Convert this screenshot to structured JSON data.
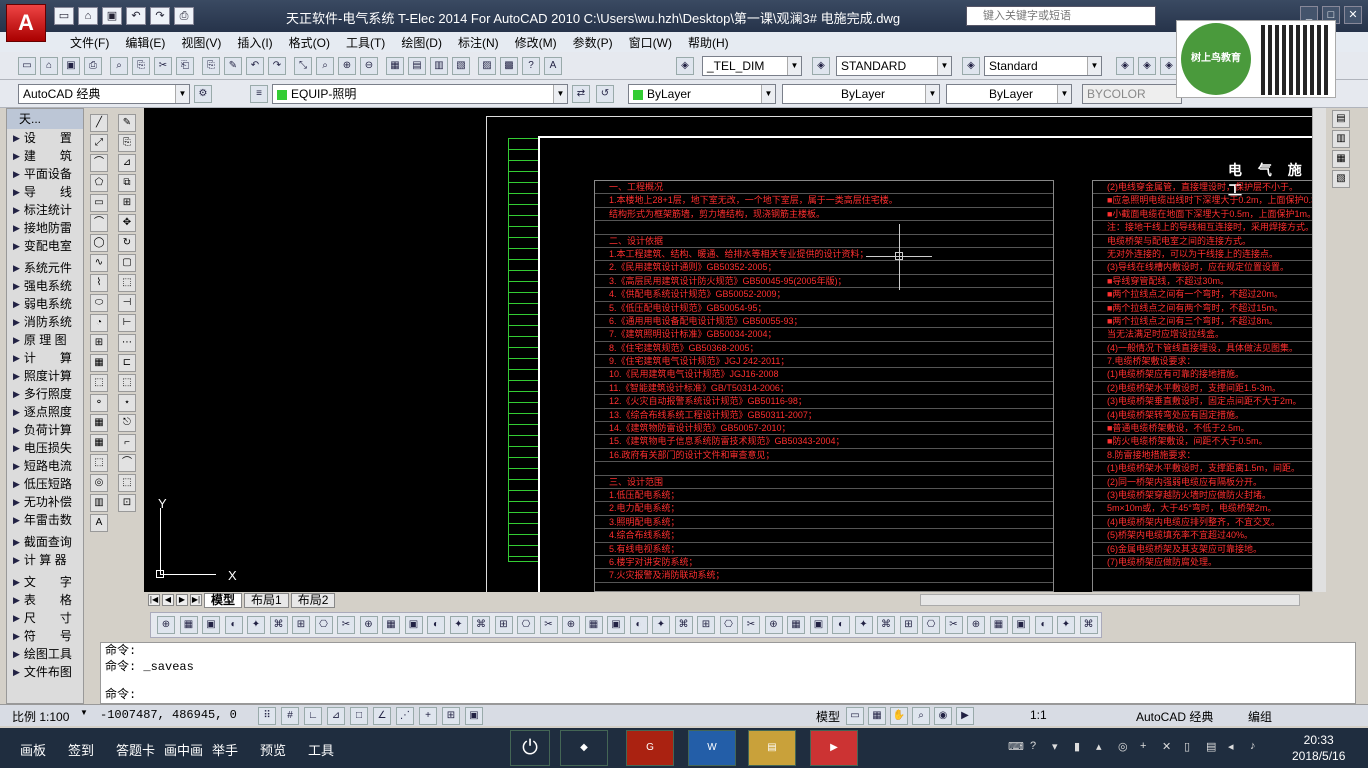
{
  "window": {
    "title": "天正软件-电气系统 T-Elec 2014  For AutoCAD 2010    C:\\Users\\wu.hzh\\Desktop\\第一课\\观澜3# 电施完成.dwg",
    "search_placeholder": "键入关键字或短语",
    "logo_letter": "A"
  },
  "menu": [
    "文件(F)",
    "编辑(E)",
    "视图(V)",
    "插入(I)",
    "格式(O)",
    "工具(T)",
    "绘图(D)",
    "标注(N)",
    "修改(M)",
    "参数(P)",
    "窗口(W)",
    "帮助(H)"
  ],
  "watermark": {
    "logo_text": "树上鸟教育"
  },
  "toolbar2": {
    "dimstyle": "_TEL_DIM",
    "textstyle": "STANDARD",
    "tablestyle": "Standard"
  },
  "toolbar3": {
    "workspace": "AutoCAD 经典",
    "layer": "EQUIP-照明",
    "color": "ByLayer",
    "linetype": "ByLayer",
    "lineweight": "ByLayer",
    "plotstyle": "BYCOLOR"
  },
  "leftpanel": {
    "title": "天...",
    "items": [
      "设　　置",
      "建　　筑",
      "平面设备",
      "导　　线",
      "标注统计",
      "接地防雷",
      "变配电室",
      "",
      "系统元件",
      "强电系统",
      "弱电系统",
      "消防系统",
      "原 理 图",
      "计　　算",
      "照度计算",
      "多行照度",
      "逐点照度",
      "负荷计算",
      "电压损失",
      "短路电流",
      "低压短路",
      "无功补偿",
      "年雷击数",
      "",
      "截面查询",
      "计 算 器",
      "",
      "文　　字",
      "表　　格",
      "尺　　寸",
      "符　　号",
      "绘图工具",
      "文件布图"
    ]
  },
  "drawing": {
    "sheet_title": "电 气 施 工",
    "col1": [
      "一、工程概况",
      "1.本楼地上28+1层，地下室无改，一个地下室层，属于一类高层住宅楼。",
      "结构形式为框架筋墙，剪力墙结构，现浇钢筋主楼板。",
      "",
      "二、设计依据",
      "1.本工程建筑、结构、暖通、给排水等相关专业提供的设计资料；",
      "2.《民用建筑设计通则》GB50352-2005；",
      "3.《高层民用建筑设计防火规范》GB50045-95(2005年版)；",
      "4.《供配电系统设计规范》GB50052-2009；",
      "5.《低压配电设计规范》GB50054-95；",
      "6.《通用用电设备配电设计规范》GB50055-93；",
      "7.《建筑照明设计标准》GB50034-2004；",
      "8.《住宅建筑规范》GB50368-2005；",
      "9.《住宅建筑电气设计规范》JGJ 242-2011；",
      "10.《民用建筑电气设计规范》JGJ16-2008",
      "11.《智能建筑设计标准》GB/T50314-2006；",
      "12.《火灾自动报警系统设计规范》GB50116-98；",
      "13.《综合布线系统工程设计规范》GB50311-2007；",
      "14.《建筑物防雷设计规范》GB50057-2010；",
      "15.《建筑物电子信息系统防雷技术规范》GB50343-2004；",
      "16.政府有关部门的设计文件和审查意见；",
      "",
      "三、设计范围",
      "1.低压配电系统；",
      "2.电力配电系统；",
      "3.照明配电系统；",
      "4.综合布线系统；",
      "5.有线电视系统；",
      "6.楼宇对讲安防系统；",
      "7.火灾报警及消防联动系统；"
    ],
    "col2": [
      "(2)电线穿金属管，直接埋设时，保护层不小于。",
      "■应急照明电缆出线时下深埋大于0.2m，上面保护0.3m。",
      "■小截面电缆在地面下深埋大于0.5m，上面保护1m。",
      "注：接地干线上的导线相互连接时，采用焊接方式。",
      "电缆桥架与配电室之间的连接方式。",
      "无对外连接的，可以为干线接上的连接点。",
      "(3)导线在线槽内敷设时，应在规定位置设置。",
      "■导线穿管配线，不超过30m。",
      "■两个拉线点之间有一个弯时，不超过20m。",
      "■两个拉线点之间有两个弯时，不超过15m。",
      "■两个拉线点之间有三个弯时，不超过8m。",
      "当无法满足时应增设拉线盒。",
      "(4)一般情况下管线直接埋设，具体做法见图集。",
      "7.电缆桥架敷设要求：",
      "(1)电缆桥架应有可靠的接地措施。",
      "(2)电缆桥架水平敷设时，支撑间距1.5-3m。",
      "(3)电缆桥架垂直敷设时，固定点间距不大于2m。",
      "(4)电缆桥架转弯处应有固定措施。",
      "■普通电缆桥架敷设，不低于2.5m。",
      "■防火电缆桥架敷设，间距不大于0.5m。",
      "8.防雷接地措施要求：",
      "(1)电缆桥架水平敷设时，支撑距离1.5m，间距。",
      "(2)同一桥架内强弱电缆应有隔板分开。",
      "(3)电缆桥架穿越防火墙时应做防火封堵。",
      "5m×10m或，大于45°弯时，电缆桥架2m。",
      "(4)电缆桥架内电缆应排列整齐，不宜交叉。",
      "(5)桥架内电缆填充率不宜超过40%。",
      "(6)金属电缆桥架及其支架应可靠接地。",
      "(7)电缆桥架应做防腐处理。"
    ]
  },
  "layout_tabs": [
    "模型",
    "布局1",
    "布局2"
  ],
  "command": {
    "lines": [
      "命令:",
      "命令: _saveas",
      "命令:"
    ]
  },
  "status": {
    "scale": "比例 1:100",
    "coords": "-1007487, 486945, 0",
    "model": "模型",
    "annoscale": "1:1",
    "workspace": "AutoCAD 经典",
    "edit": "编组"
  },
  "taskbar": {
    "items": [
      "画板",
      "签到",
      "答题卡",
      "画中画",
      "举手",
      "预览",
      "工具"
    ],
    "time": "20:33",
    "date": "2018/5/16"
  },
  "colors": {
    "accent": "#ff3030",
    "canvas": "#000000",
    "frame_green": "#33cc33"
  }
}
